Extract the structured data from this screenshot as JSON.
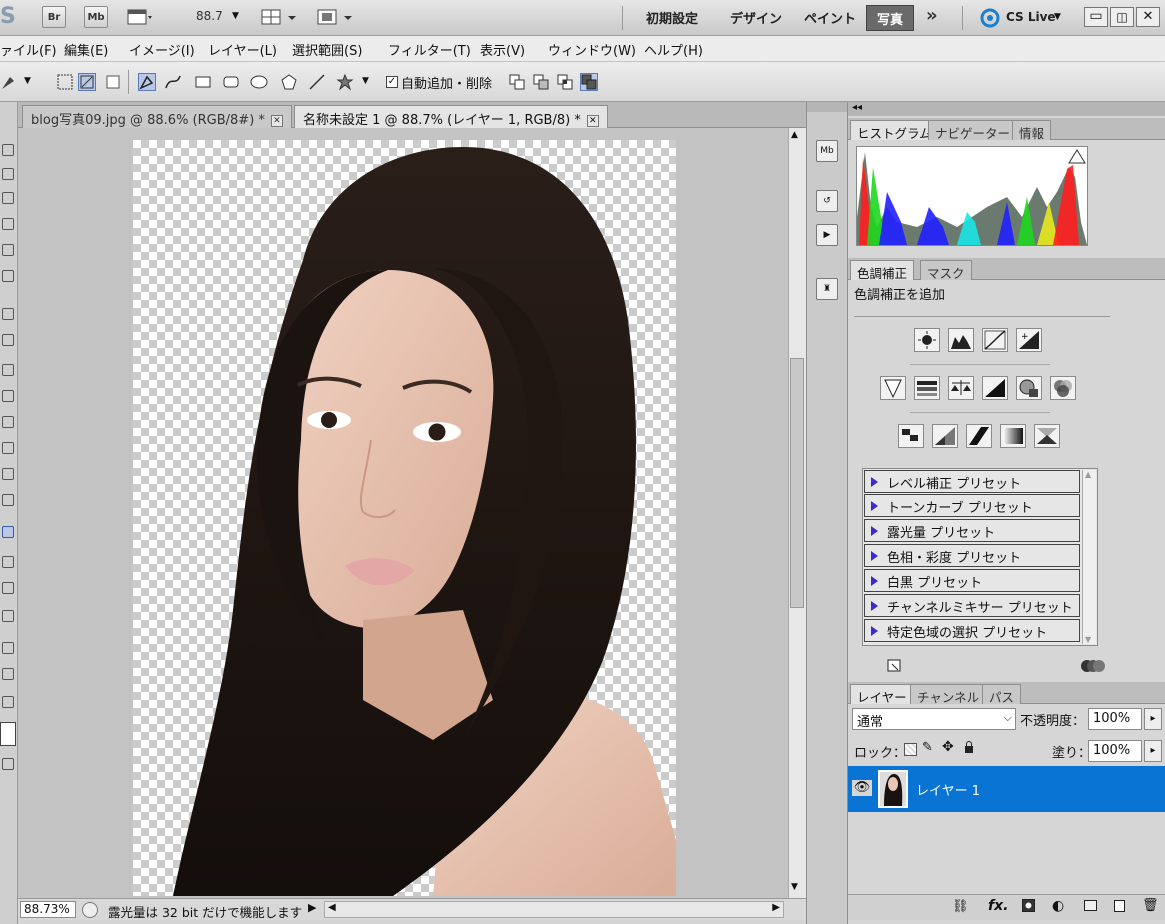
{
  "app_bar": {
    "logo_partial": "S",
    "br_label": "Br",
    "mb_label": "Mb",
    "zoom_value": "88.7",
    "workspaces": [
      "初期設定",
      "デザイン",
      "ペイント",
      "写真"
    ],
    "active_workspace": "写真",
    "more_label": "»",
    "cs_live_label": "CS Live"
  },
  "menu": {
    "items": [
      "ァイル(F)",
      "編集(E)",
      "イメージ(I)",
      "レイヤー(L)",
      "選択範囲(S)",
      "フィルター(T)",
      "表示(V)",
      "ウィンドウ(W)",
      "ヘルプ(H)"
    ]
  },
  "options": {
    "auto_add_delete_label": "自動追加・削除",
    "auto_add_delete_checked": true
  },
  "documents": {
    "tabs": [
      {
        "label": "blog写真09.jpg @ 88.6% (RGB/8#) *",
        "active": false
      },
      {
        "label": "名称未設定 1 @ 88.7% (レイヤー 1, RGB/8) *",
        "active": true
      }
    ]
  },
  "status": {
    "zoom": "88.73%",
    "message": "露光量は 32 bit だけで機能します"
  },
  "panels": {
    "histogram_tabs": [
      "ヒストグラム",
      "ナビゲーター",
      "情報"
    ],
    "adjust_tabs": [
      "色調補正",
      "マスク"
    ],
    "adjust_title": "色調補正を追加",
    "presets": [
      "レベル補正 プリセット",
      "トーンカーブ プリセット",
      "露光量 プリセット",
      "色相・彩度 プリセット",
      "白黒 プリセット",
      "チャンネルミキサー プリセット",
      "特定色域の選択 プリセット"
    ],
    "layers_tabs": [
      "レイヤー",
      "チャンネル",
      "パス"
    ],
    "blend_mode": "通常",
    "opacity_label": "不透明度：",
    "opacity_value": "100%",
    "lock_label": "ロック：",
    "fill_label": "塗り：",
    "fill_value": "100%",
    "layer_name": "レイヤー 1"
  },
  "colors": {
    "layer_selected": "#0a74d4",
    "active_workspace_bg": "#6a6a6a"
  }
}
